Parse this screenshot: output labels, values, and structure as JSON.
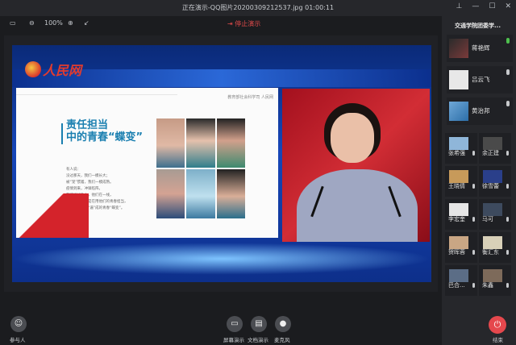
{
  "window": {
    "title": "正在演示-QQ图片20200309212537.jpg 01:00:11",
    "controls": [
      "pin-icon",
      "minimize-icon",
      "maximize-icon",
      "close-icon"
    ]
  },
  "toolbar": {
    "zoom_level": "100%",
    "stop_label": "停止演示"
  },
  "slide": {
    "logo_text": "人民网",
    "doc_header": "教育部社会科学司 人民网",
    "heading_line1": "责任担当",
    "heading_line2": "中的青春“蝶变”",
    "body_lines": [
      "有人说：",
      "没过那天，我们一模长大；",
      "被“宠”惯着，我们一模成熟。",
      "疫情到来，冲锋陷阵，",
      "在这场战争中，他们在一线，",
      "在病房中，都是在用他们的青春担当，",
      "他们都成了被“逼”成的青春“蝶变”。"
    ]
  },
  "room": {
    "name": "交通学院团委学..."
  },
  "speakers": [
    {
      "name": "蒋艳辉",
      "mic": "on"
    },
    {
      "name": "吕云飞",
      "mic": "off"
    },
    {
      "name": "黄治邦",
      "mic": "off"
    }
  ],
  "participants": [
    {
      "name": "张希强"
    },
    {
      "name": "余正建"
    },
    {
      "name": "王晓倩"
    },
    {
      "name": "徐雪蕾"
    },
    {
      "name": "李宏奎"
    },
    {
      "name": "马可"
    },
    {
      "name": "贺晖蓉"
    },
    {
      "name": "衡汇东"
    },
    {
      "name": "巴合..."
    },
    {
      "name": "朱鑫"
    }
  ],
  "bottom": {
    "participants_label": "参与人",
    "screen_share_label": "屏幕演示",
    "doc_share_label": "文档演示",
    "mic_label": "麦克风",
    "end_label": "结束"
  },
  "colors": {
    "accent_stop": "#e04a4a",
    "end_button": "#e5484d",
    "mic_on": "#4ec04e"
  }
}
